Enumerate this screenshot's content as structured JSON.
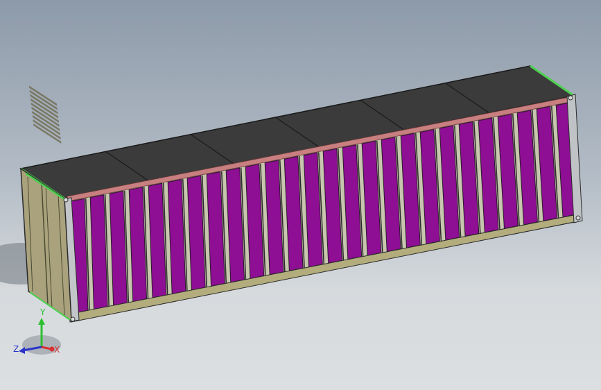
{
  "viewport": {
    "background_top": "#8d9aa9",
    "background_bottom": "#dcdfe1"
  },
  "model": {
    "name": "shipping-container",
    "roof_color": "#3a3a3a",
    "side_panel_color": "#8e0e94",
    "rib_color": "#c9c7a9",
    "frame_color": "#c8c6ae",
    "front_color": "#a9a27c",
    "edge_highlight": "#4cd14f",
    "top_rail": "#c87f7f",
    "corrugation_count": 26,
    "roof_segments": 6
  },
  "triad": {
    "x_label": "X",
    "y_label": "Y",
    "z_label": "Z",
    "x_color": "#d83030",
    "y_color": "#2cc030",
    "z_color": "#2a34c8"
  }
}
